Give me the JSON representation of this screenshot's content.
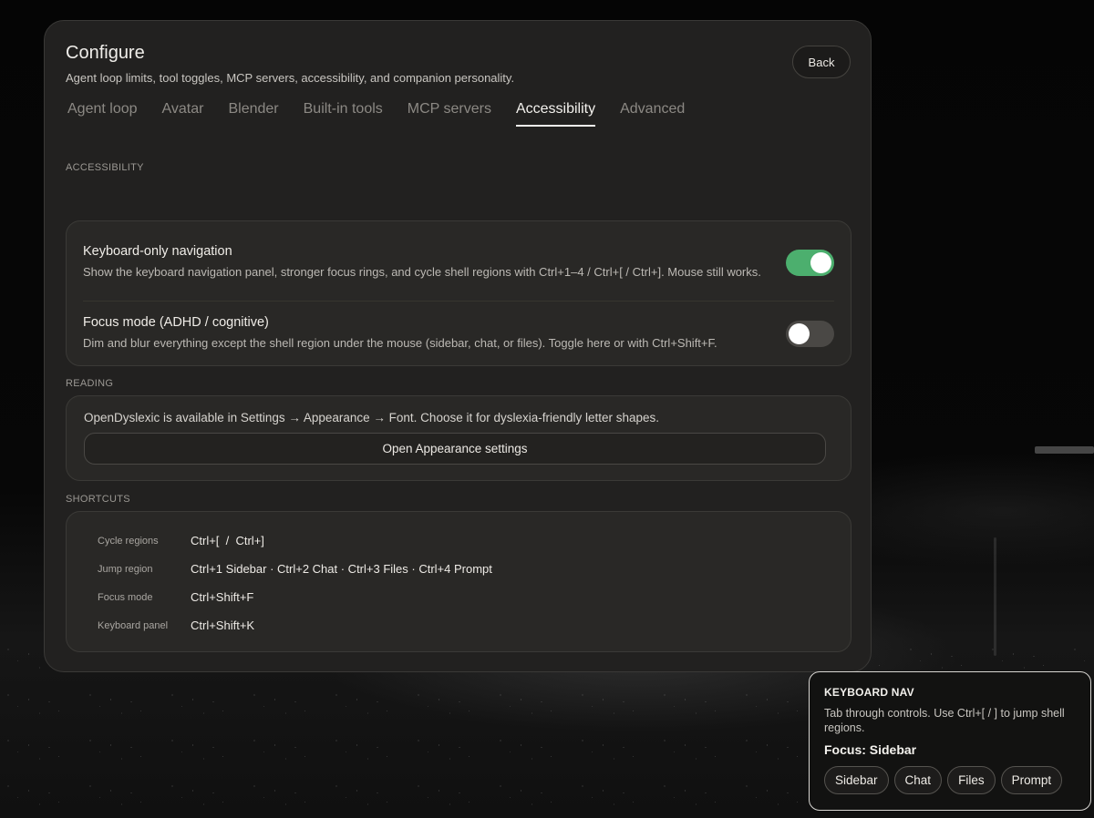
{
  "dialog": {
    "title": "Configure",
    "subtitle": "Agent loop limits, tool toggles, MCP servers, accessibility, and companion personality.",
    "back_label": "Back"
  },
  "tabs": [
    {
      "label": "Agent loop",
      "active": false
    },
    {
      "label": "Avatar",
      "active": false
    },
    {
      "label": "Blender",
      "active": false
    },
    {
      "label": "Built-in tools",
      "active": false
    },
    {
      "label": "MCP servers",
      "active": false
    },
    {
      "label": "Accessibility",
      "active": true
    },
    {
      "label": "Advanced",
      "active": false
    }
  ],
  "accessibility": {
    "section_label": "ACCESSIBILITY",
    "items": [
      {
        "title": "Keyboard-only navigation",
        "description": "Show the keyboard navigation panel, stronger focus rings, and cycle shell regions with Ctrl+1–4 / Ctrl+[ / Ctrl+]. Mouse still works.",
        "enabled": true
      },
      {
        "title": "Focus mode (ADHD / cognitive)",
        "description": "Dim and blur everything except the shell region under the mouse (sidebar, chat, or files). Toggle here or with Ctrl+Shift+F.",
        "enabled": false
      }
    ]
  },
  "reading": {
    "section_label": "READING",
    "text": "OpenDyslexic is available in Settings → Appearance → Font. Choose it for dyslexia-friendly letter shapes.",
    "button_label": "Open Appearance settings"
  },
  "shortcuts": {
    "section_label": "SHORTCUTS",
    "rows": [
      {
        "label": "Cycle regions",
        "value": "Ctrl+[  /  Ctrl+]"
      },
      {
        "label": "Jump region",
        "value": "Ctrl+1 Sidebar · Ctrl+2 Chat · Ctrl+3 Files · Ctrl+4 Prompt"
      },
      {
        "label": "Focus mode",
        "value": "Ctrl+Shift+F"
      },
      {
        "label": "Keyboard panel",
        "value": "Ctrl+Shift+K"
      }
    ]
  },
  "keyboard_nav_panel": {
    "title": "KEYBOARD NAV",
    "description": "Tab through controls. Use Ctrl+[ / ] to jump shell regions.",
    "focus_text": "Focus: Sidebar",
    "regions": [
      "Sidebar",
      "Chat",
      "Files",
      "Prompt"
    ]
  },
  "colors": {
    "toggle_on": "#4caf6e",
    "toggle_off": "#4a4845",
    "dialog_bg": "#222120"
  }
}
